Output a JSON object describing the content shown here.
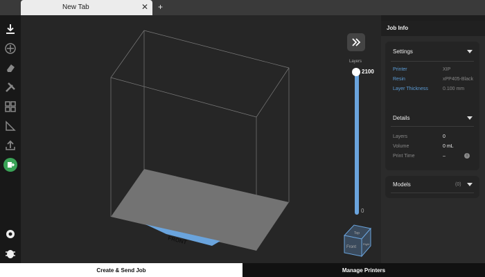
{
  "tab": {
    "title": "New Tab"
  },
  "viewport": {
    "layers_label": "Layers",
    "layer_max": "2100",
    "layer_min": "0",
    "build_plate_label": "FRONT"
  },
  "view_cube": {
    "top": "Top",
    "front": "Front",
    "right": "Right"
  },
  "panel": {
    "title": "Job Info",
    "settings": {
      "title": "Settings",
      "printer_label": "Printer",
      "printer_value": "XIP",
      "resin_label": "Resin",
      "resin_value": "xPP405-Black",
      "layer_thickness_label": "Layer Thickness",
      "layer_thickness_value": "0.100 mm"
    },
    "details": {
      "title": "Details",
      "layers_label": "Layers",
      "layers_value": "0",
      "volume_label": "Volume",
      "volume_value": "0 mL",
      "print_time_label": "Print Time",
      "print_time_value": "–"
    },
    "models": {
      "title": "Models",
      "count": "(0)"
    }
  },
  "bottom": {
    "create_label": "Create & Send Job",
    "manage_label": "Manage Printers"
  },
  "colors": {
    "accent": "#6aa4dd",
    "label_blue": "#5b9bd5",
    "green_button": "#3aa357",
    "plate": "#737373"
  }
}
